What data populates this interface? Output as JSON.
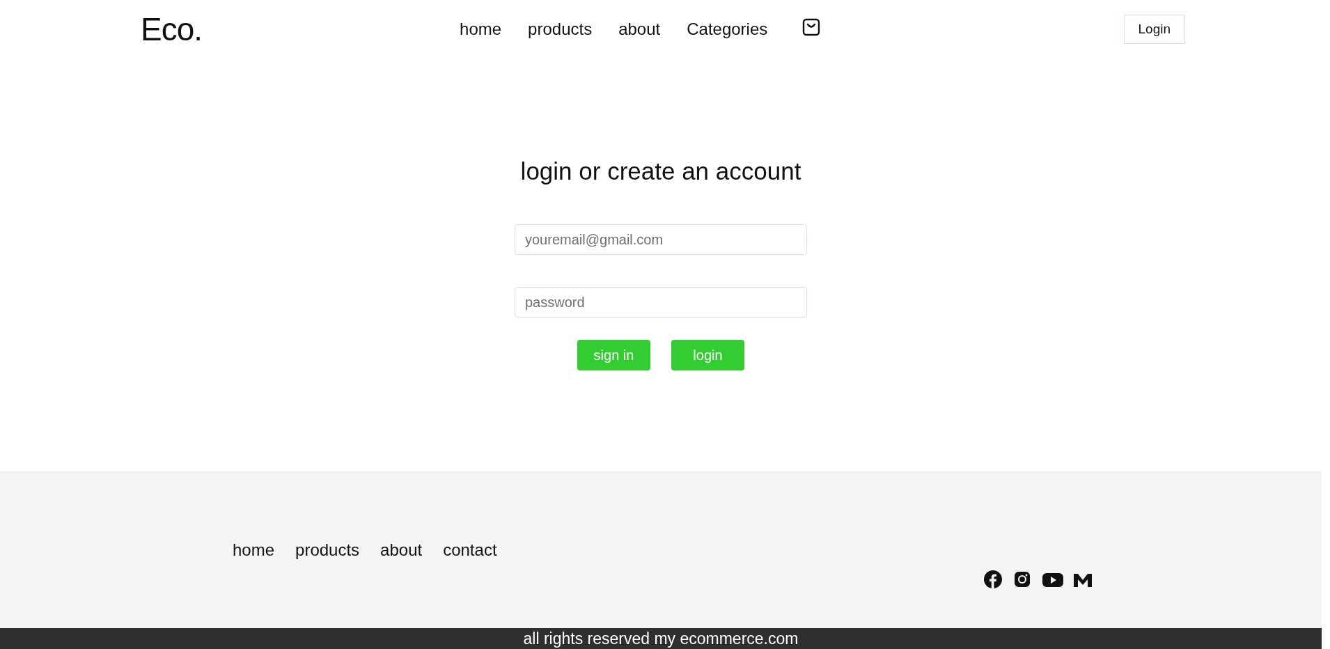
{
  "header": {
    "logo": "Eco.",
    "nav": [
      "home",
      "products",
      "about",
      "Categories"
    ],
    "login_button": "Login"
  },
  "login_form": {
    "heading": "login or create an account",
    "fields": [
      {
        "placeholder": "youremail@gmail.com"
      },
      {
        "placeholder": "password"
      }
    ],
    "buttons": [
      "sign in",
      "login"
    ]
  },
  "footer": {
    "links": [
      "home",
      "products",
      "about",
      "contact"
    ],
    "copyright": "all rights reserved my ecommerce.com"
  }
}
